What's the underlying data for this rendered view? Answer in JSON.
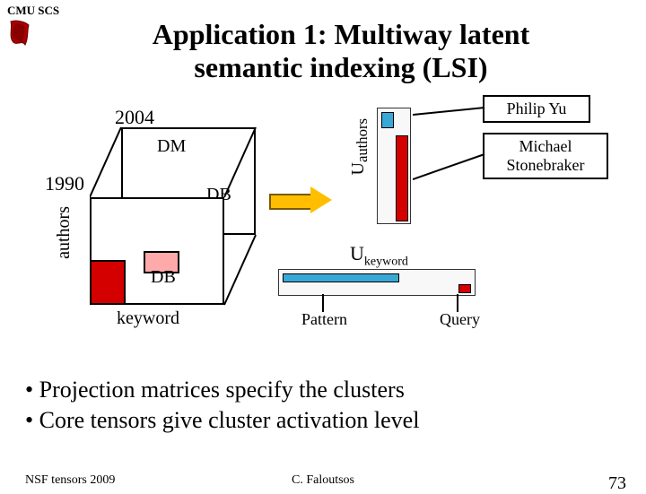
{
  "header": {
    "org": "CMU SCS",
    "title_line1": "Application 1: Multiway latent",
    "title_line2": "semantic indexing (LSI)"
  },
  "diagram": {
    "year_back": "2004",
    "year_front": "1990",
    "topic_dm": "DM",
    "topic_db_back": "DB",
    "topic_db_front": "DB",
    "axis_authors": "authors",
    "axis_keyword": "keyword",
    "u_authors_label": "authors",
    "u_authors_prefix": "U",
    "u_keyword_label": "keyword",
    "u_keyword_prefix": "U",
    "callout_philip": "Philip Yu",
    "callout_michael_l1": "Michael",
    "callout_michael_l2": "Stonebraker",
    "kw_pattern": "Pattern",
    "kw_query": "Query"
  },
  "bullets": {
    "b1": "Projection matrices specify the clusters",
    "b2": "Core tensors give cluster activation level"
  },
  "footer": {
    "left": "NSF tensors 2009",
    "center": "C. Faloutsos",
    "page": "73"
  }
}
